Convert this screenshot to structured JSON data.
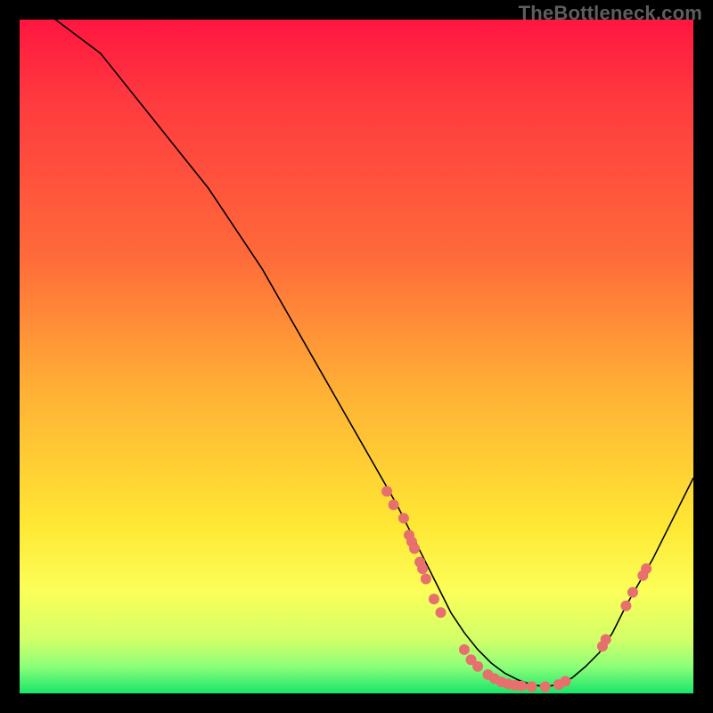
{
  "watermark": "TheBottleneck.com",
  "colors": {
    "frame": "#000000",
    "gradient_top": "#ff163f",
    "gradient_bottom": "#19e56a",
    "curve": "#000000",
    "points": "#e76f6e"
  },
  "chart_data": {
    "type": "line",
    "title": "",
    "xlabel": "",
    "ylabel": "",
    "xlim": [
      0,
      100
    ],
    "ylim": [
      0,
      100
    ],
    "curve": {
      "x": [
        0,
        4,
        8,
        12,
        16,
        20,
        24,
        28,
        32,
        36,
        40,
        44,
        48,
        52,
        56,
        58,
        60,
        62,
        64,
        66,
        68,
        70,
        72,
        74,
        76,
        78,
        80,
        82,
        84,
        86,
        88,
        90,
        94,
        98,
        100
      ],
      "y": [
        104,
        101,
        98,
        95,
        90,
        85,
        80,
        75,
        69,
        63,
        56,
        49,
        42,
        35,
        28,
        24,
        20,
        16,
        12,
        9,
        6.5,
        4.5,
        3,
        2,
        1.3,
        1.0,
        1.3,
        2.3,
        4.0,
        6.0,
        9.0,
        13.0,
        20.0,
        28.0,
        32.0
      ]
    },
    "points": [
      {
        "x": 54.5,
        "y": 30.0
      },
      {
        "x": 55.5,
        "y": 28.0
      },
      {
        "x": 57.0,
        "y": 26.0
      },
      {
        "x": 57.8,
        "y": 23.5
      },
      {
        "x": 58.2,
        "y": 22.5
      },
      {
        "x": 58.6,
        "y": 21.5
      },
      {
        "x": 59.4,
        "y": 19.5
      },
      {
        "x": 59.8,
        "y": 18.5
      },
      {
        "x": 60.3,
        "y": 17.0
      },
      {
        "x": 61.5,
        "y": 14.0
      },
      {
        "x": 62.5,
        "y": 12.0
      },
      {
        "x": 66.0,
        "y": 6.5
      },
      {
        "x": 67.0,
        "y": 5.0
      },
      {
        "x": 68.0,
        "y": 4.0
      },
      {
        "x": 69.5,
        "y": 2.8
      },
      {
        "x": 70.5,
        "y": 2.2
      },
      {
        "x": 71.5,
        "y": 1.7
      },
      {
        "x": 72.5,
        "y": 1.4
      },
      {
        "x": 73.5,
        "y": 1.2
      },
      {
        "x": 74.5,
        "y": 1.1
      },
      {
        "x": 76.0,
        "y": 1.0
      },
      {
        "x": 78.0,
        "y": 1.0
      },
      {
        "x": 80.0,
        "y": 1.3
      },
      {
        "x": 81.0,
        "y": 1.8
      },
      {
        "x": 86.5,
        "y": 7.0
      },
      {
        "x": 87.0,
        "y": 8.0
      },
      {
        "x": 90.0,
        "y": 13.0
      },
      {
        "x": 91.0,
        "y": 15.0
      },
      {
        "x": 92.5,
        "y": 17.5
      },
      {
        "x": 93.0,
        "y": 18.5
      }
    ]
  }
}
